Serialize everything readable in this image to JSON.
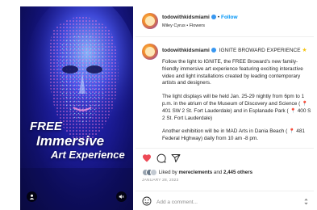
{
  "media": {
    "overlay_line1": "FREE",
    "overlay_line2": "Immersive",
    "overlay_line3": "Art Experience",
    "user_tag_icon": "person-icon",
    "sound_icon": "speaker-muted-icon"
  },
  "header": {
    "username": "todowithkidsmiami",
    "follow_separator": "•",
    "follow_label": "Follow",
    "subtitle": "Miley Cyrus • Flowers"
  },
  "caption": {
    "username": "todowithkidsmiami",
    "title": "IGNITE BROWARD EXPERIENCE",
    "title_icon": "star",
    "line1": "Follow the light to IGNITE, the FREE Broward's new family-",
    "line2": "friendly immersive art experience featuring exciting interactive",
    "line3": "video and light installations created by leading contemporary",
    "line4": "artists and designers.",
    "line5": "The light displays will be held Jan. 25-29 nightly from 6pm to 1",
    "line6": "p.m. in the atrium of the Museum of Discovery and Science (",
    "line7": "401 SW 2 St. Fort Lauderdale) and in Esplanade Park (",
    "line7b": "400 S",
    "line8": "2 St. Fort Lauderdale)",
    "line9": "Another exhibition will be in MAD Arts in Dania Beach (",
    "line9b": "481",
    "line10": "Federal Highway) daily from 10 am -8 pm.",
    "pin_icon": "pin-icon"
  },
  "actions": {
    "like_icon": "heart-filled-icon",
    "comment_icon": "comment-icon",
    "share_icon": "send-icon",
    "like_color": "#ed4956"
  },
  "likes": {
    "prefix": "Liked by",
    "user": "mereclements",
    "conjunction": "and",
    "others": "2,445 others"
  },
  "date": "JANUARY 28, 2023",
  "comment": {
    "placeholder": "Add a comment...",
    "emoji_icon": "smiley-icon",
    "post_icon": "arrows-icon"
  }
}
